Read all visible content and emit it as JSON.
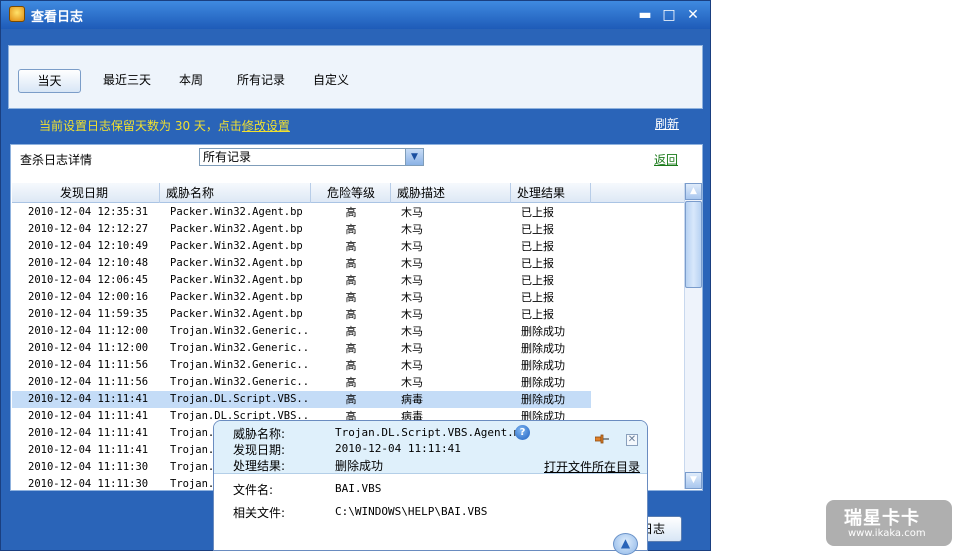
{
  "window": {
    "title": "查看日志",
    "min_glyph": "▬",
    "max_glyph": "□",
    "close_glyph": "✕"
  },
  "tabs": [
    {
      "label": "当天",
      "active": true
    },
    {
      "label": "最近三天",
      "active": false
    },
    {
      "label": "本周",
      "active": false
    },
    {
      "label": "所有记录",
      "active": false
    },
    {
      "label": "自定义",
      "active": false
    }
  ],
  "notice": {
    "prefix": "当前设置日志保留天数为 30 天，点击",
    "link": "修改设置"
  },
  "refresh_label": "刷新",
  "detail_label": "查杀日志详情",
  "filter": {
    "selected": "所有记录"
  },
  "back_label": "返回",
  "table": {
    "headers": [
      "发现日期",
      "威胁名称",
      "危险等级",
      "威胁描述",
      "处理结果"
    ],
    "rows": [
      [
        "2010-12-04 12:35:31",
        "Packer.Win32.Agent.bp",
        "高",
        "木马",
        "已上报"
      ],
      [
        "2010-12-04 12:12:27",
        "Packer.Win32.Agent.bp",
        "高",
        "木马",
        "已上报"
      ],
      [
        "2010-12-04 12:10:49",
        "Packer.Win32.Agent.bp",
        "高",
        "木马",
        "已上报"
      ],
      [
        "2010-12-04 12:10:48",
        "Packer.Win32.Agent.bp",
        "高",
        "木马",
        "已上报"
      ],
      [
        "2010-12-04 12:06:45",
        "Packer.Win32.Agent.bp",
        "高",
        "木马",
        "已上报"
      ],
      [
        "2010-12-04 12:00:16",
        "Packer.Win32.Agent.bp",
        "高",
        "木马",
        "已上报"
      ],
      [
        "2010-12-04 11:59:35",
        "Packer.Win32.Agent.bp",
        "高",
        "木马",
        "已上报"
      ],
      [
        "2010-12-04 11:12:00",
        "Trojan.Win32.Generic...",
        "高",
        "木马",
        "删除成功"
      ],
      [
        "2010-12-04 11:12:00",
        "Trojan.Win32.Generic...",
        "高",
        "木马",
        "删除成功"
      ],
      [
        "2010-12-04 11:11:56",
        "Trojan.Win32.Generic...",
        "高",
        "木马",
        "删除成功"
      ],
      [
        "2010-12-04 11:11:56",
        "Trojan.Win32.Generic...",
        "高",
        "木马",
        "删除成功"
      ],
      [
        "2010-12-04 11:11:41",
        "Trojan.DL.Script.VBS...",
        "高",
        "病毒",
        "删除成功"
      ],
      [
        "2010-12-04 11:11:41",
        "Trojan.DL.Script.VBS...",
        "高",
        "病毒",
        "删除成功"
      ],
      [
        "2010-12-04 11:11:41",
        "Trojan.",
        "",
        "",
        ""
      ],
      [
        "2010-12-04 11:11:41",
        "Trojan.",
        "",
        "",
        ""
      ],
      [
        "2010-12-04 11:11:30",
        "Trojan.",
        "",
        "",
        ""
      ],
      [
        "2010-12-04 11:11:30",
        "Trojan.",
        "",
        "",
        ""
      ]
    ],
    "selected_row": 11
  },
  "bottom_button": "日志",
  "popup": {
    "threat_name_label": "威胁名称:",
    "threat_name": "Trojan.DL.Script.VBS.Agent.mm",
    "found_date_label": "发现日期:",
    "found_date": "2010-12-04 11:11:41",
    "result_label": "处理结果:",
    "result": "删除成功",
    "open_dir_label": "打开文件所在目录",
    "filename_label": "文件名:",
    "filename": "BAI.VBS",
    "related_label": "相关文件:",
    "related": "C:\\WINDOWS\\HELP\\BAI.VBS",
    "help_glyph": "?",
    "close_glyph": "✕"
  },
  "watermark": {
    "big": "瑞星卡卡",
    "small": "www.ikaka.com"
  },
  "icons": {
    "app": "shield-icon",
    "pin": "pin-icon",
    "up": "scroll-up-icon"
  }
}
